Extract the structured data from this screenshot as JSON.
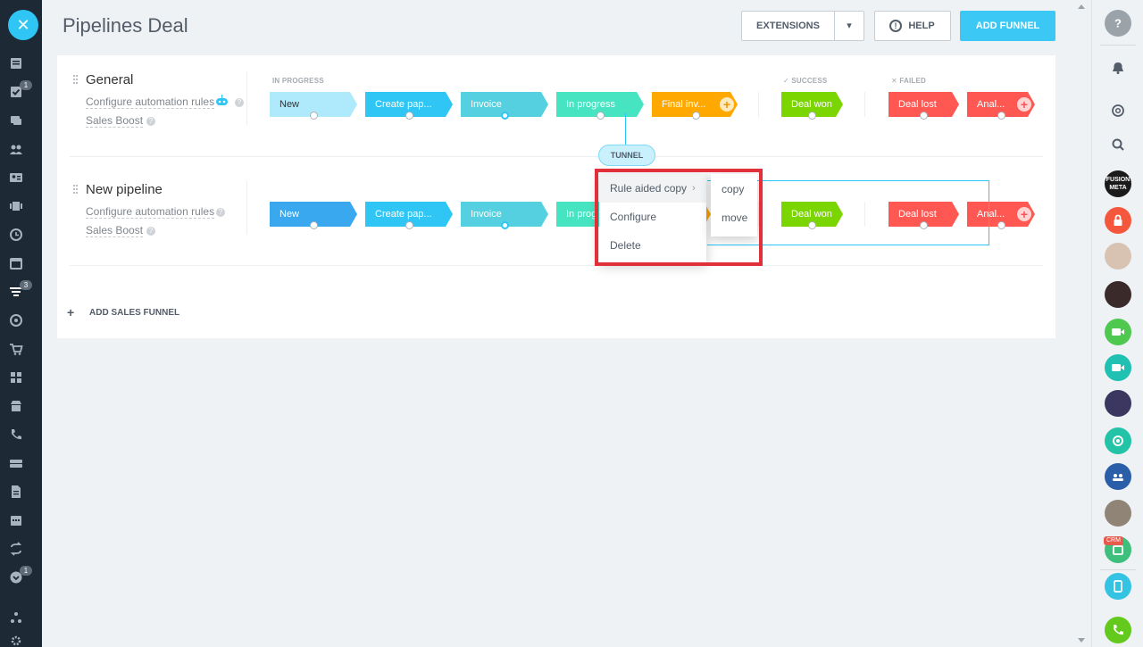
{
  "header": {
    "title": "Pipelines Deal",
    "extensions_label": "EXTENSIONS",
    "help_label": "HELP",
    "add_funnel_label": "ADD FUNNEL"
  },
  "categories": {
    "in_progress": "IN PROGRESS",
    "success": "SUCCESS",
    "failed": "FAILED"
  },
  "pipelines": [
    {
      "name": "General",
      "automation_link": "Configure automation rules",
      "boost_link": "Sales Boost",
      "stages": [
        "New",
        "Create pap...",
        "Invoice",
        "In progress",
        "Final inv..."
      ],
      "success_stage": "Deal won",
      "failed_stages": [
        "Deal lost",
        "Anal..."
      ]
    },
    {
      "name": "New pipeline",
      "automation_link": "Configure automation rules",
      "boost_link": "Sales Boost",
      "stages": [
        "New",
        "Create pap...",
        "Invoice",
        "In prog"
      ],
      "success_stage": "Deal won",
      "failed_stages": [
        "Deal lost",
        "Anal..."
      ]
    }
  ],
  "stage_colors": {
    "new_general": "#aee9fc",
    "new_pipeline": "#39a8ef",
    "create_paper": "#2fc6f6",
    "invoice": "#55d0e0",
    "in_progress": "#47e4c2",
    "final_invoice": "#ffa900",
    "deal_won": "#7bd500",
    "deal_lost": "#ff5752",
    "analysis": "#ff5752"
  },
  "tunnel_label": "TUNNEL",
  "context_menu": {
    "items": [
      "Rule aided copy",
      "Configure",
      "Delete"
    ],
    "submenu": [
      "copy",
      "move"
    ]
  },
  "add_sales_funnel_label": "ADD SALES FUNNEL",
  "left_nav_badges": [
    "1",
    "3",
    "1"
  ],
  "right_bar": {
    "crm_tag": "CRM",
    "fusion_avatar_text": "FUSION META"
  },
  "icons": {
    "close": "✕",
    "help_circle": "!",
    "caret": "▾",
    "question": "?",
    "plus": "+",
    "menu_arrow": "›"
  }
}
